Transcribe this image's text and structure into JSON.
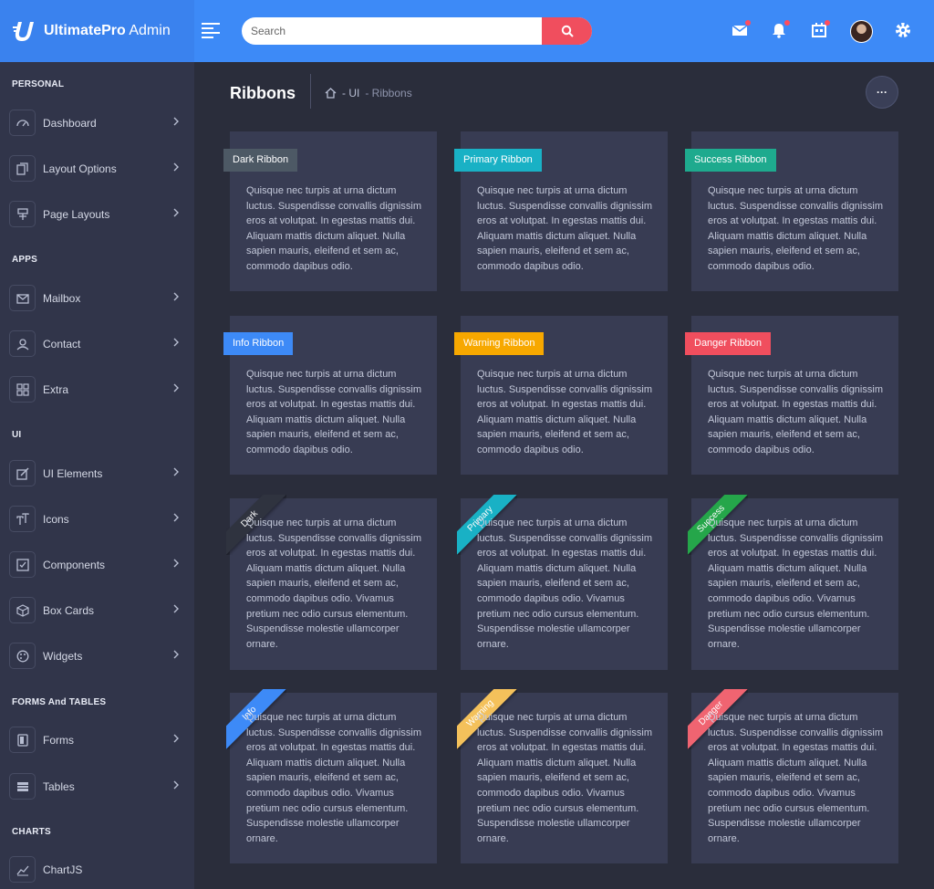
{
  "brand": {
    "name_bold": "UltimatePro",
    "name_light": "Admin"
  },
  "header": {
    "search_placeholder": "Search",
    "icons": [
      "menu-icon",
      "search-icon",
      "mail-icon",
      "bell-icon",
      "calendar-icon",
      "avatar",
      "gear-icon"
    ]
  },
  "colors": {
    "header": "#3d8af7",
    "search_button": "#f04e5e",
    "dark": "#4d5965",
    "primary": "#19b1c5",
    "success": "#1eaa8e",
    "info": "#3d8af7",
    "warning": "#f7a800",
    "danger": "#f04e5e"
  },
  "sidebar": {
    "sections": [
      {
        "title": "PERSONAL",
        "items": [
          {
            "label": "Dashboard",
            "icon": "dashboard-icon"
          },
          {
            "label": "Layout Options",
            "icon": "copy-icon"
          },
          {
            "label": "Page Layouts",
            "icon": "layout-icon"
          }
        ]
      },
      {
        "title": "APPS",
        "items": [
          {
            "label": "Mailbox",
            "icon": "mail-icon"
          },
          {
            "label": "Contact",
            "icon": "user-icon"
          },
          {
            "label": "Extra",
            "icon": "grid-icon"
          }
        ]
      },
      {
        "title": "UI",
        "items": [
          {
            "label": "UI Elements",
            "icon": "edit-icon"
          },
          {
            "label": "Icons",
            "icon": "font-icon"
          },
          {
            "label": "Components",
            "icon": "checkbox-icon"
          },
          {
            "label": "Box Cards",
            "icon": "box-icon"
          },
          {
            "label": "Widgets",
            "icon": "palette-icon"
          }
        ]
      },
      {
        "title": "FORMS And TABLES",
        "items": [
          {
            "label": "Forms",
            "icon": "form-icon"
          },
          {
            "label": "Tables",
            "icon": "table-icon"
          }
        ]
      },
      {
        "title": "CHARTS",
        "items": [
          {
            "label": "ChartJS",
            "icon": "chart-icon"
          }
        ]
      }
    ]
  },
  "page": {
    "title": "Ribbons",
    "breadcrumb": [
      "- UI",
      "- Ribbons"
    ],
    "more_label": "···"
  },
  "text": {
    "short": "Quisque nec turpis at urna dictum luctus. Suspendisse convallis dignissim eros at volutpat. In egestas mattis dui. Aliquam mattis dictum aliquet. Nulla sapien mauris, eleifend et sem ac, commodo dapibus odio.",
    "long_suffix": "Vivamus pretium nec odio cursus elementum. Suspendisse molestie ullamcorper ornare."
  },
  "ribbons": {
    "rect": [
      {
        "label": "Dark Ribbon",
        "color": "#4d5965"
      },
      {
        "label": "Primary Ribbon",
        "color": "#19b1c5"
      },
      {
        "label": "Success Ribbon",
        "color": "#1eaa8e"
      },
      {
        "label": "Info Ribbon",
        "color": "#3d8af7"
      },
      {
        "label": "Warning Ribbon",
        "color": "#f7a800"
      },
      {
        "label": "Danger Ribbon",
        "color": "#f04e5e"
      }
    ],
    "corner": [
      {
        "label": "Dark",
        "color": "#2f333f"
      },
      {
        "label": "Primary",
        "color": "#19b1c5"
      },
      {
        "label": "Success",
        "color": "#25a64a"
      },
      {
        "label": "Info",
        "color": "#3d8af7"
      },
      {
        "label": "Warning",
        "color": "#f4c15b"
      },
      {
        "label": "Danger",
        "color": "#f06471"
      }
    ]
  }
}
